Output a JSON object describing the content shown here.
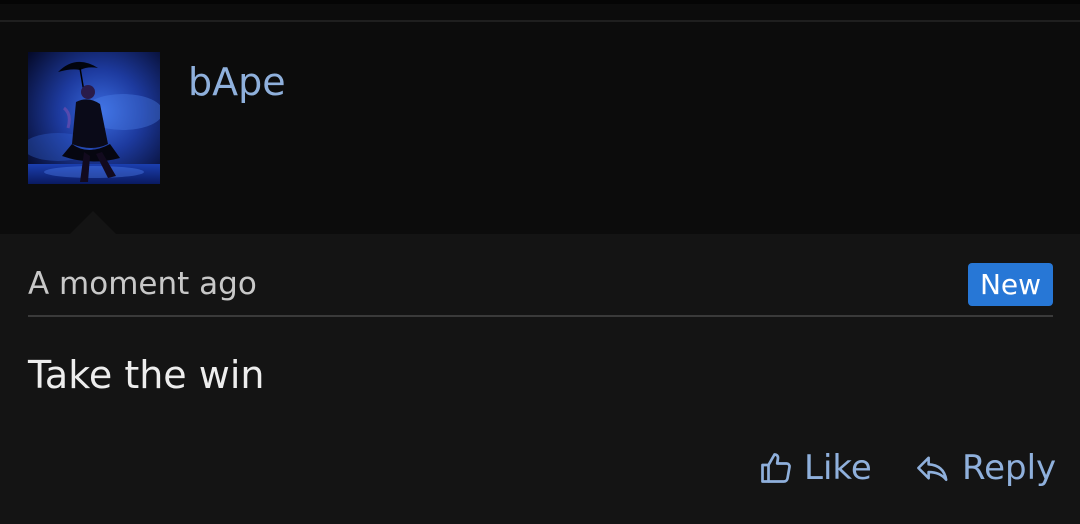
{
  "post": {
    "username": "bApe",
    "timestamp": "A moment ago",
    "badge": "New",
    "message": "Take the win",
    "actions": {
      "like_label": "Like",
      "reply_label": "Reply"
    },
    "avatar_icon": "avatar-image",
    "colors": {
      "username": "#8fb0dc",
      "badge_bg": "#2777d6",
      "panel_bg": "#141414",
      "page_bg": "#0c0c0c"
    }
  }
}
